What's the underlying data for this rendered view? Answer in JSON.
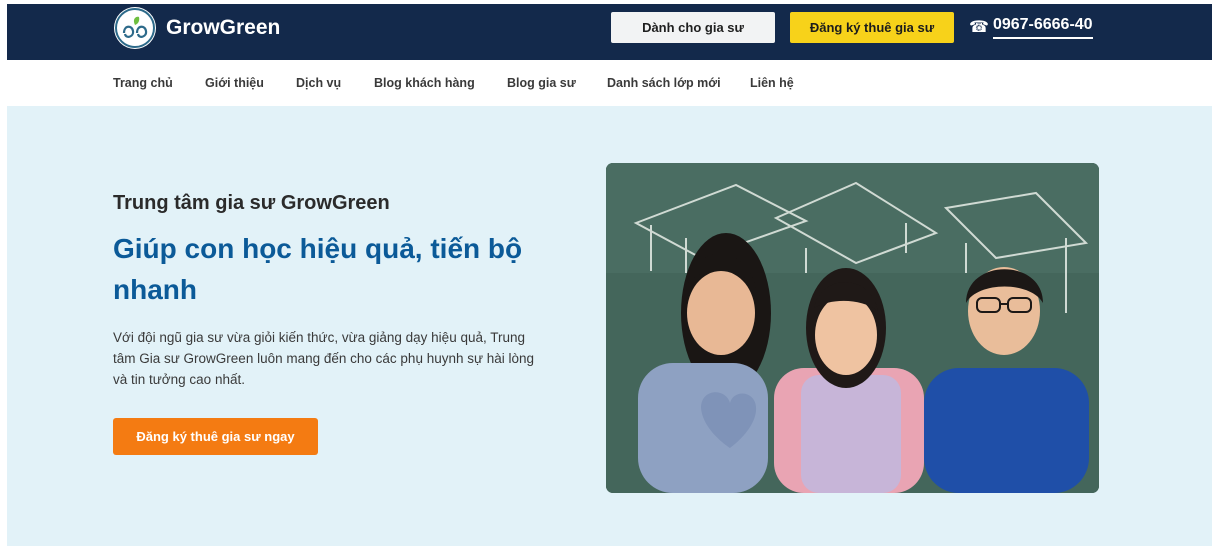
{
  "header": {
    "logo_text": "GrowGreen",
    "tutor_button": "Dành cho gia sư",
    "hire_button": "Đăng ký thuê gia sư",
    "phone_icon": "☎",
    "phone": "0967-6666-40"
  },
  "nav": {
    "items": [
      "Trang chủ",
      "Giới thiệu",
      "Dịch vụ",
      "Blog khách hàng",
      "Blog gia sư",
      "Danh sách lớp mới",
      "Liên hệ"
    ]
  },
  "hero": {
    "kicker": "Trung tâm gia sư GrowGreen",
    "headline": "Giúp con học hiệu quả, tiến bộ nhanh",
    "description": "Với đội ngũ gia sư vừa giỏi kiến thức, vừa giảng dạy hiệu quả, Trung tâm Gia sư GrowGreen luôn mang đến cho các phụ huynh sự hài lòng và tin tưởng cao nhất.",
    "cta": "Đăng ký thuê gia sư ngay"
  },
  "colors": {
    "topbar": "#13294b",
    "hire_button": "#f7d21a",
    "hero_bg": "#e2f2f8",
    "headline": "#0b5a98",
    "cta": "#f47b12"
  },
  "icons": {
    "logo": "growgreen-logo-icon",
    "phone": "phone-icon"
  }
}
